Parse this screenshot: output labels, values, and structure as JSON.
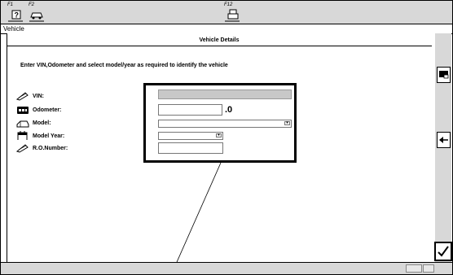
{
  "toolbar": {
    "f1_label": "F1",
    "f2_label": "F2",
    "f12_label": "F12",
    "f1_icon": "help-icon",
    "f2_icon": "vehicle-icon",
    "f12_icon": "print-icon"
  },
  "window": {
    "title": "Vehicle"
  },
  "section": {
    "title": "Vehicle Details"
  },
  "instruction": "Enter VIN,Odometer and select model/year as required to identify the vehicle",
  "fields": {
    "vin": {
      "label": "VIN:",
      "icon": "vin-icon",
      "value": ""
    },
    "odometer": {
      "label": "Odometer:",
      "icon": "odometer-icon",
      "value": "",
      "suffix": ".0"
    },
    "model": {
      "label": "Model:",
      "icon": "model-icon",
      "value": ""
    },
    "model_year": {
      "label": "Model Year:",
      "icon": "calendar-icon",
      "value": ""
    },
    "ro_number": {
      "label": "R.O.Number:",
      "icon": "ro-number-icon",
      "value": ""
    }
  },
  "sidebar": {
    "buttons": [
      "screen-icon",
      "back-arrow-icon"
    ]
  },
  "confirm": {
    "icon": "checkmark-icon"
  },
  "colors": {
    "frame": "#000000",
    "toolbar_bg": "#d8d8d8",
    "vin_field": "#c8c8c8"
  }
}
